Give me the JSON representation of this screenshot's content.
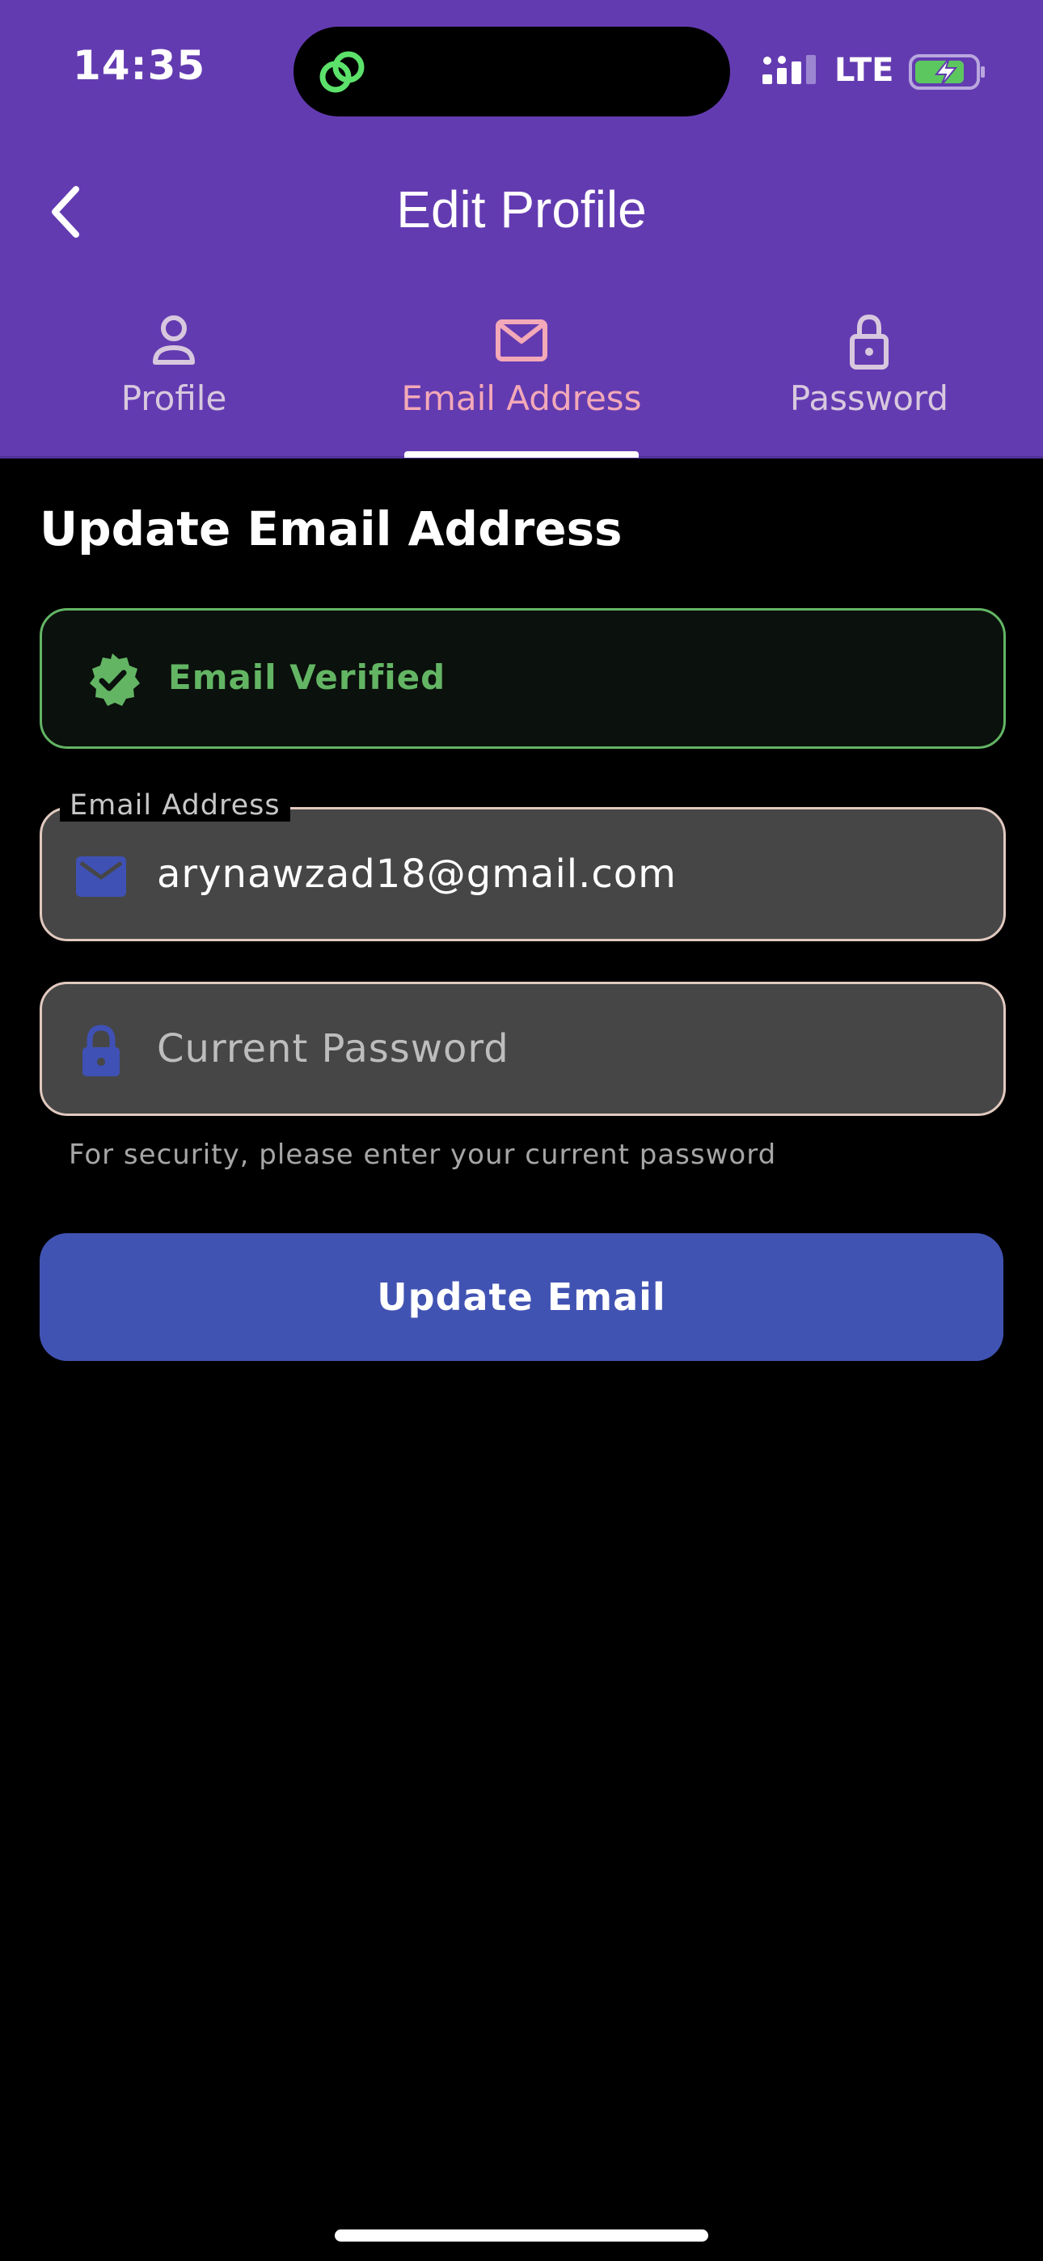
{
  "status_bar": {
    "time": "14:35",
    "network": "LTE"
  },
  "header": {
    "title": "Edit Profile",
    "back_icon": "chevron-left-icon"
  },
  "tabs": [
    {
      "label": "Profile",
      "icon": "person-icon",
      "active": false
    },
    {
      "label": "Email Address",
      "icon": "envelope-icon",
      "active": true
    },
    {
      "label": "Password",
      "icon": "lock-icon",
      "active": false
    }
  ],
  "main": {
    "section_title": "Update Email Address",
    "verified_banner": {
      "text": "Email Verified",
      "icon": "verified-badge-icon"
    },
    "email_field": {
      "label": "Email Address",
      "value": "arynawzad18@gmail.com",
      "icon": "mail-icon"
    },
    "password_field": {
      "placeholder": "Current Password",
      "value": "",
      "icon": "lock-icon",
      "helper": "For security, please enter your current password"
    },
    "submit_label": "Update Email"
  },
  "colors": {
    "header_bg": "#633BB1",
    "active_tab": "#F3A9B8",
    "inactive_tab": "#D8C8DE",
    "verified": "#63B564",
    "field_bg": "#464646",
    "field_border": "#E1C9BF",
    "button": "#4153B2",
    "icon_blue": "#3F51B5"
  }
}
